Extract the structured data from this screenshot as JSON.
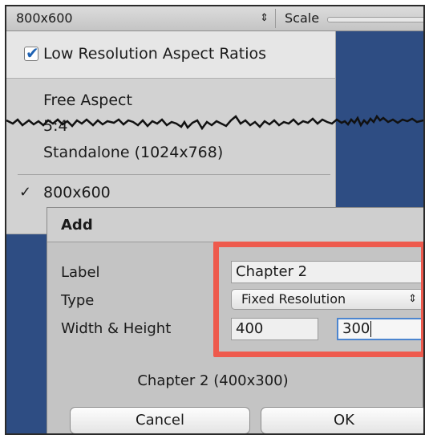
{
  "toolbar": {
    "resolution_value": "800x600",
    "resolution_arrow": "⇕",
    "scale_label": "Scale"
  },
  "menu": {
    "low_res_checkbox": {
      "label": "Low Resolution Aspect Ratios",
      "checked": true
    },
    "items": [
      {
        "label": "Free Aspect"
      },
      {
        "label": "5:4"
      },
      {
        "label": "Standalone (1024x768)"
      },
      {
        "label": "800x600",
        "checked": true
      }
    ],
    "checkmark_glyph": "✓"
  },
  "dialog": {
    "title": "Add",
    "label_field": {
      "label": "Label",
      "value": "Chapter 2"
    },
    "type_field": {
      "label": "Type",
      "value": "Fixed Resolution",
      "arrow": "⇕"
    },
    "size_field": {
      "label": "Width & Height",
      "width": "400",
      "height": "300"
    },
    "summary": "Chapter 2 (400x300)",
    "cancel_label": "Cancel",
    "ok_label": "OK"
  },
  "colors": {
    "game_view_bg": "#2e4d83",
    "highlight": "#ee5a4d",
    "focus_ring": "#4c85cf",
    "checkbox_check": "#1f62b3"
  }
}
